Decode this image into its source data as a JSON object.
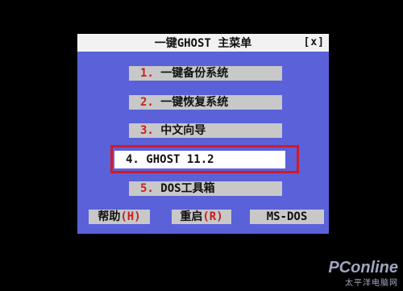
{
  "window": {
    "title": "一键GHOST 主菜单",
    "close_label": "[x]"
  },
  "menu": {
    "items": [
      {
        "num": "1.",
        "label": "一键备份系统"
      },
      {
        "num": "2.",
        "label": "一键恢复系统"
      },
      {
        "num": "3.",
        "label": "中文向导"
      },
      {
        "num": "4.",
        "label": "GHOST 11.2"
      },
      {
        "num": "5.",
        "label": "DOS工具箱"
      }
    ]
  },
  "buttons": {
    "help_label": "帮助",
    "help_key": "(H)",
    "reboot_label": "重启",
    "reboot_key": "(R)",
    "msdos_label": "MS-DOS"
  },
  "watermark": {
    "brand": "PConline",
    "sub": "太平洋电脑网"
  },
  "colors": {
    "window_bg": "#5a61d9",
    "highlight_frame": "#d11a2a",
    "hotkey": "#c81e1e"
  }
}
